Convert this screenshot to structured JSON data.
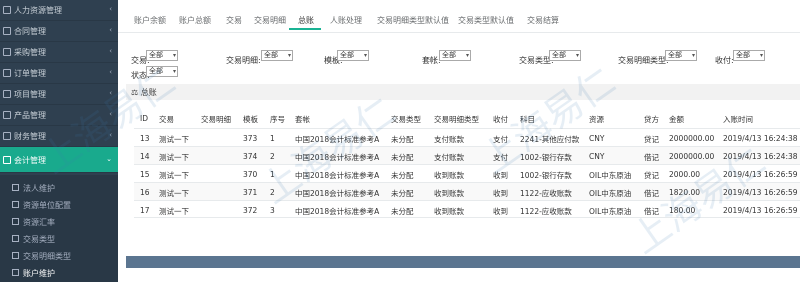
{
  "sidebar": {
    "items": [
      {
        "label": "人力资源管理",
        "arrow": "‹"
      },
      {
        "label": "合同管理",
        "arrow": "‹"
      },
      {
        "label": "采购管理",
        "arrow": "‹"
      },
      {
        "label": "订单管理",
        "arrow": "‹"
      },
      {
        "label": "项目管理",
        "arrow": "‹"
      },
      {
        "label": "产品管理",
        "arrow": "‹"
      },
      {
        "label": "财务管理",
        "arrow": "‹"
      },
      {
        "label": "会计管理",
        "arrow": "⌄"
      }
    ],
    "sub_items": [
      {
        "label": "法人维护"
      },
      {
        "label": "资源单位配置"
      },
      {
        "label": "资源汇率"
      },
      {
        "label": "交易类型"
      },
      {
        "label": "交易明细类型"
      },
      {
        "label": "账户维护"
      }
    ]
  },
  "tabs": [
    {
      "label": "账户余额"
    },
    {
      "label": "账户总额"
    },
    {
      "label": "交易"
    },
    {
      "label": "交易明细"
    },
    {
      "label": "总账"
    },
    {
      "label": "人账处理"
    },
    {
      "label": "交易明细类型默认值"
    },
    {
      "label": "交易类型默认值"
    },
    {
      "label": "交易结算"
    }
  ],
  "filters": {
    "jiaoyi": {
      "label": "交易:",
      "value": "全部"
    },
    "jiaoyimingxi": {
      "label": "交易明细:",
      "value": "全部"
    },
    "moban": {
      "label": "模板:",
      "value": "全部"
    },
    "taozhang": {
      "label": "套帐:",
      "value": "全部"
    },
    "jiaoyileixing": {
      "label": "交易类型:",
      "value": "全部"
    },
    "mingxileixing": {
      "label": "交易明细类型:",
      "value": "全部"
    },
    "shoufu": {
      "label": "收付:",
      "value": "全部"
    },
    "zhuangtai": {
      "label": "状态:",
      "value": "全部"
    }
  },
  "section_title": "总账",
  "table": {
    "headers": [
      "ID",
      "交易",
      "交易明细",
      "模板",
      "序号",
      "套帐",
      "交易类型",
      "交易明细类型",
      "收付",
      "科目",
      "资源",
      "贷方",
      "金额",
      "入账时间"
    ],
    "rows": [
      [
        "13",
        "测试一下",
        "",
        "373",
        "1",
        "中国2018会计标准参考A",
        "未分配",
        "支付账款",
        "支付",
        "2241-其他应付款",
        "CNY",
        "贷记",
        "2000000.00",
        "2019/4/13 16:24:38"
      ],
      [
        "14",
        "测试一下",
        "",
        "374",
        "2",
        "中国2018会计标准参考A",
        "未分配",
        "支付账款",
        "支付",
        "1002-银行存款",
        "CNY",
        "借记",
        "2000000.00",
        "2019/4/13 16:24:38"
      ],
      [
        "15",
        "测试一下",
        "",
        "370",
        "1",
        "中国2018会计标准参考A",
        "未分配",
        "收到账款",
        "收到",
        "1002-银行存款",
        "OIL中东原油",
        "贷记",
        "2000.00",
        "2019/4/13 16:26:59"
      ],
      [
        "16",
        "测试一下",
        "",
        "371",
        "2",
        "中国2018会计标准参考A",
        "未分配",
        "收到账款",
        "收到",
        "1122-应收账款",
        "OIL中东原油",
        "借记",
        "1820.00",
        "2019/4/13 16:26:59"
      ],
      [
        "17",
        "测试一下",
        "",
        "372",
        "3",
        "中国2018会计标准参考A",
        "未分配",
        "收到账款",
        "收到",
        "1122-应收账款",
        "OIL中东原油",
        "借记",
        "180.00",
        "2019/4/13 16:26:59"
      ]
    ]
  },
  "watermark": "上海易仁"
}
